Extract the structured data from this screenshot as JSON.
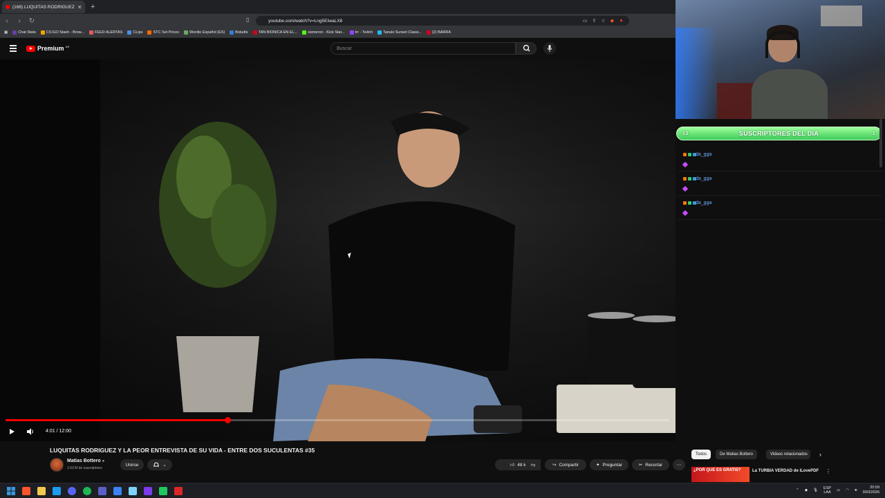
{
  "browser": {
    "tab_title": "(168) LUQUITAS RODRIGUEZ",
    "url": "youtube.com/watch?v=Lng5EIwaLX8",
    "bookmarks": [
      {
        "label": "Chat Stats",
        "color": "#6441a5"
      },
      {
        "label": "CS:GO Stash - Brow...",
        "color": "#f0a500"
      },
      {
        "label": "FEED ALERTAS",
        "color": "#e05c5c"
      },
      {
        "label": "CLips",
        "color": "#4a90e2"
      },
      {
        "label": "STC Set Prices",
        "color": "#ff6a00"
      },
      {
        "label": "Wordle Español (ES)",
        "color": "#6aaa64"
      },
      {
        "label": "Boludle",
        "color": "#3a7bd5"
      },
      {
        "label": "TAN BIONICA EN EL...",
        "color": "#d0021b"
      },
      {
        "label": "sismeron - Kick Stat...",
        "color": "#53fc18"
      },
      {
        "label": "trr - Twitch",
        "color": "#9146ff"
      },
      {
        "label": "Tanuki Sunset Classi...",
        "color": "#2bb5f0"
      },
      {
        "label": "(2) BARRA",
        "color": "#d0021b"
      }
    ]
  },
  "youtube": {
    "logo_text": "Premium",
    "region": "AR",
    "search_placeholder": "Buscar"
  },
  "player": {
    "time": "4:01 / 12:00",
    "progress": 0.334
  },
  "video": {
    "title": "LUQUITAS RODRIGUEZ Y LA PEOR ENTREVISTA DE SU VIDA - ENTRE DOS SUCULENTAS #35",
    "channel": "Matias Bottero",
    "subscribers": "1.63 M de suscriptores",
    "join_label": "Unirse",
    "likes": "48 k",
    "share_label": "Compartir",
    "ask_label": "Preguntar",
    "clip_label": "Recortar"
  },
  "recs": {
    "chips": [
      "Todos",
      "De Matias Bottero",
      "Videos relacionados"
    ],
    "first_title": "La TURBIA VERDAD de iLovePDF",
    "first_thumb_text": "¿POR QUE ES GRATIS?"
  },
  "overlay": {
    "bar_left": "13",
    "bar_title": "SUSCRIPTORES DEL DIA",
    "bar_right": "1",
    "feed": [
      {
        "name": "da_gga"
      },
      {
        "name": "da_gga"
      },
      {
        "name": "da_gga"
      }
    ]
  },
  "taskbar": {
    "lang_top": "ESP",
    "lang_bottom": "LAA",
    "time": "20:59",
    "date": "30/3/2026"
  }
}
